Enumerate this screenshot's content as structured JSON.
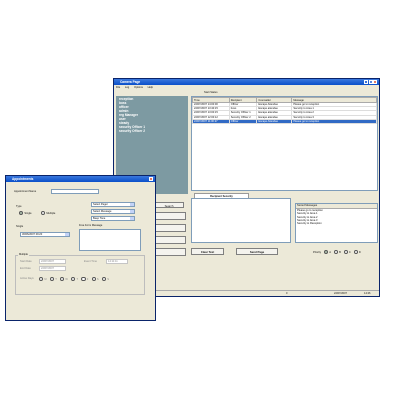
{
  "main_window": {
    "title": "Camera Page",
    "menu": [
      "File",
      "Log",
      "Options",
      "Help"
    ],
    "toolbar_label": "Start Status",
    "user_list": [
      "reception",
      "boss",
      "officer",
      "admin",
      "reg Manager",
      "user",
      "steady",
      "security Officer 1",
      "security Officer 2"
    ],
    "grid_headers": [
      "Time",
      "Recipient",
      "Counseller",
      "Message"
    ],
    "grid_rows": [
      [
        "22/07/2007 14:00:00",
        "Officer",
        "Escape Attendee",
        "Please go to reception"
      ],
      [
        "22/07/2007 13:40:15",
        "boss",
        "Escape attendee",
        "Security to Area 1"
      ],
      [
        "22/07/2007 13:00:15",
        "Security Officer 1",
        "Escape attendee",
        "Security to Area 2"
      ],
      [
        "22/07/2007 12:00:12",
        "Security Officer 2",
        "Escape attendee",
        "Security to Area 3"
      ],
      [
        "22/07/2007 11:00:27",
        "Officer",
        "Escape Attendee",
        "Please go to reception"
      ]
    ],
    "search_button": "Search",
    "recipient_tab": "Recipient Security",
    "stored_messages": {
      "header": "Stored Messages",
      "items": [
        "Please go to reception",
        "Security to Area 1",
        "Security to Area 2",
        "Security to Area 3",
        "Security to Reception"
      ]
    },
    "clear_text_button": "Clear Text",
    "send_page_button": "Send Page",
    "priority": {
      "label": "Priority",
      "options": [
        "A",
        "B",
        "C",
        "D"
      ]
    },
    "status": {
      "count": "0",
      "date": "22/07/2007",
      "time": "14:26"
    }
  },
  "appt_window": {
    "title": "Appointments",
    "appointment_name_label": "Appointment Name",
    "type_label": "Type",
    "type_options": [
      "Single",
      "Multiple"
    ],
    "single_label": "Single",
    "single_date": "30/06/2007 09:20",
    "select_pager": "Select Pager",
    "select_message": "Select Message",
    "beep_tone": "Beep Tone",
    "free_form_label": "Free Form Message",
    "multiple_label": "Multiple",
    "start_date_label": "Start Date",
    "end_date_label": "End Date",
    "event_time_label": "Event Time",
    "start_date_value": "22/07/2007",
    "end_date_value": "22/07/2007",
    "event_time_value": "14:11:11",
    "active_days_label": "Active Days",
    "days": [
      "M",
      "T",
      "W",
      "T",
      "F",
      "S",
      "S"
    ]
  }
}
